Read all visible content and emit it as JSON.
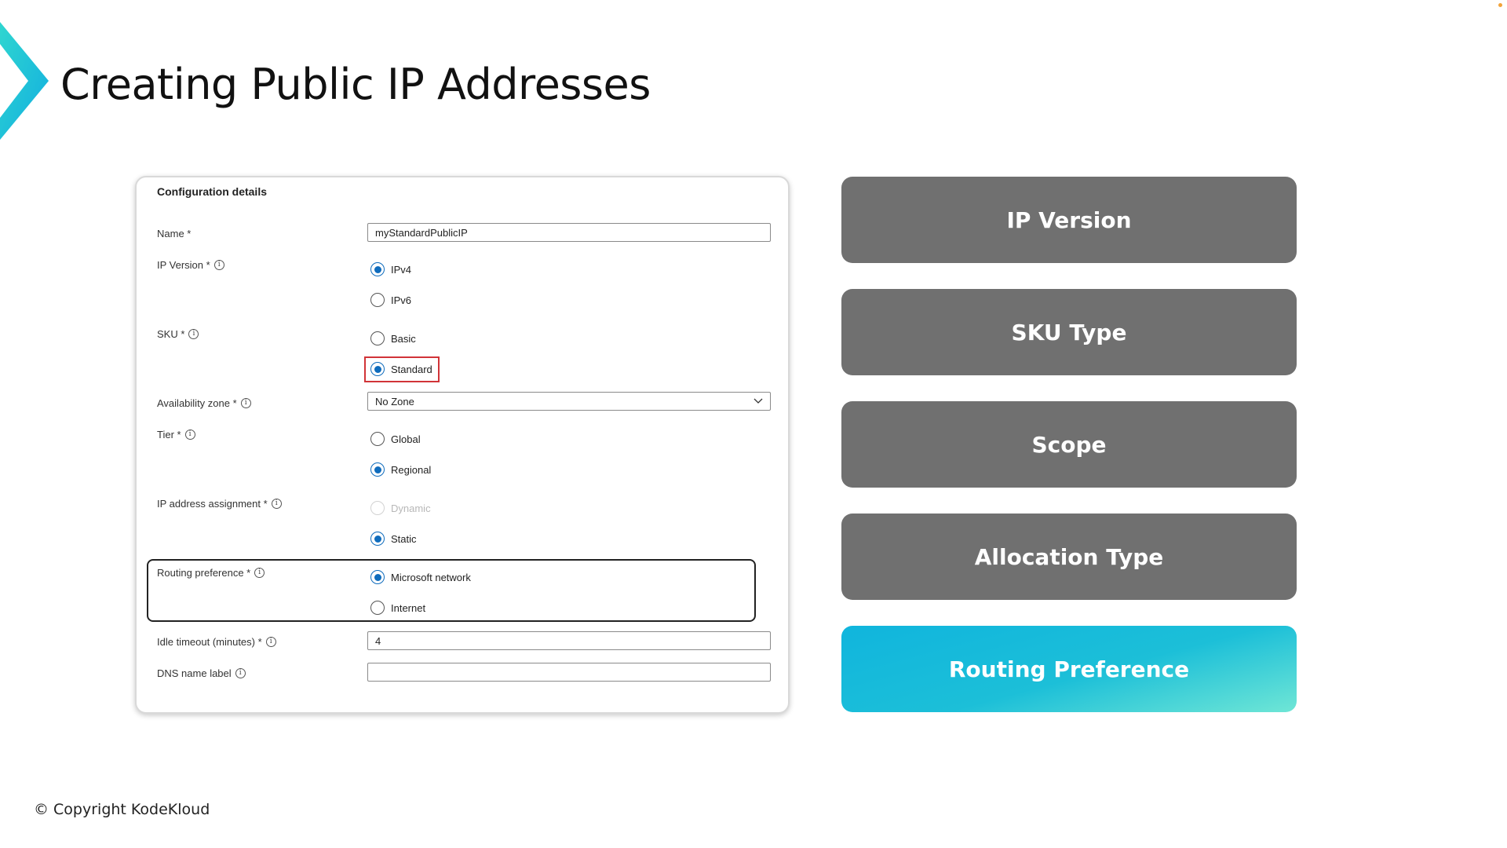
{
  "slide": {
    "title": "Creating Public IP Addresses",
    "copyright": "© Copyright KodeKloud"
  },
  "colors": {
    "accent_gradient_start": "#10b5dd",
    "accent_gradient_end": "#6fe6d6",
    "topic_inactive": "#707070",
    "radio_selected": "#0f6cbd",
    "highlight_red": "#d13438"
  },
  "form": {
    "heading": "Configuration details",
    "info_icon_glyph": "i",
    "name": {
      "label": "Name *",
      "value": "myStandardPublicIP"
    },
    "ip_version": {
      "label": "IP Version *",
      "options": [
        "IPv4",
        "IPv6"
      ],
      "selected": "IPv4"
    },
    "sku": {
      "label": "SKU *",
      "options": [
        "Basic",
        "Standard"
      ],
      "selected": "Standard"
    },
    "availability_zone": {
      "label": "Availability zone *",
      "value": "No Zone"
    },
    "tier": {
      "label": "Tier *",
      "options": [
        "Global",
        "Regional"
      ],
      "selected": "Regional"
    },
    "ip_assignment": {
      "label": "IP address assignment *",
      "options": [
        "Dynamic",
        "Static"
      ],
      "selected": "Static",
      "disabled": [
        "Dynamic"
      ]
    },
    "routing_preference": {
      "label": "Routing preference *",
      "options": [
        "Microsoft network",
        "Internet"
      ],
      "selected": "Microsoft network"
    },
    "idle_timeout": {
      "label": "Idle timeout (minutes) *",
      "value": "4"
    },
    "dns_label": {
      "label": "DNS name label",
      "value": ""
    }
  },
  "topics": [
    {
      "label": "IP Version",
      "active": false
    },
    {
      "label": "SKU Type",
      "active": false
    },
    {
      "label": "Scope",
      "active": false
    },
    {
      "label": "Allocation Type",
      "active": false
    },
    {
      "label": "Routing Preference",
      "active": true
    }
  ]
}
